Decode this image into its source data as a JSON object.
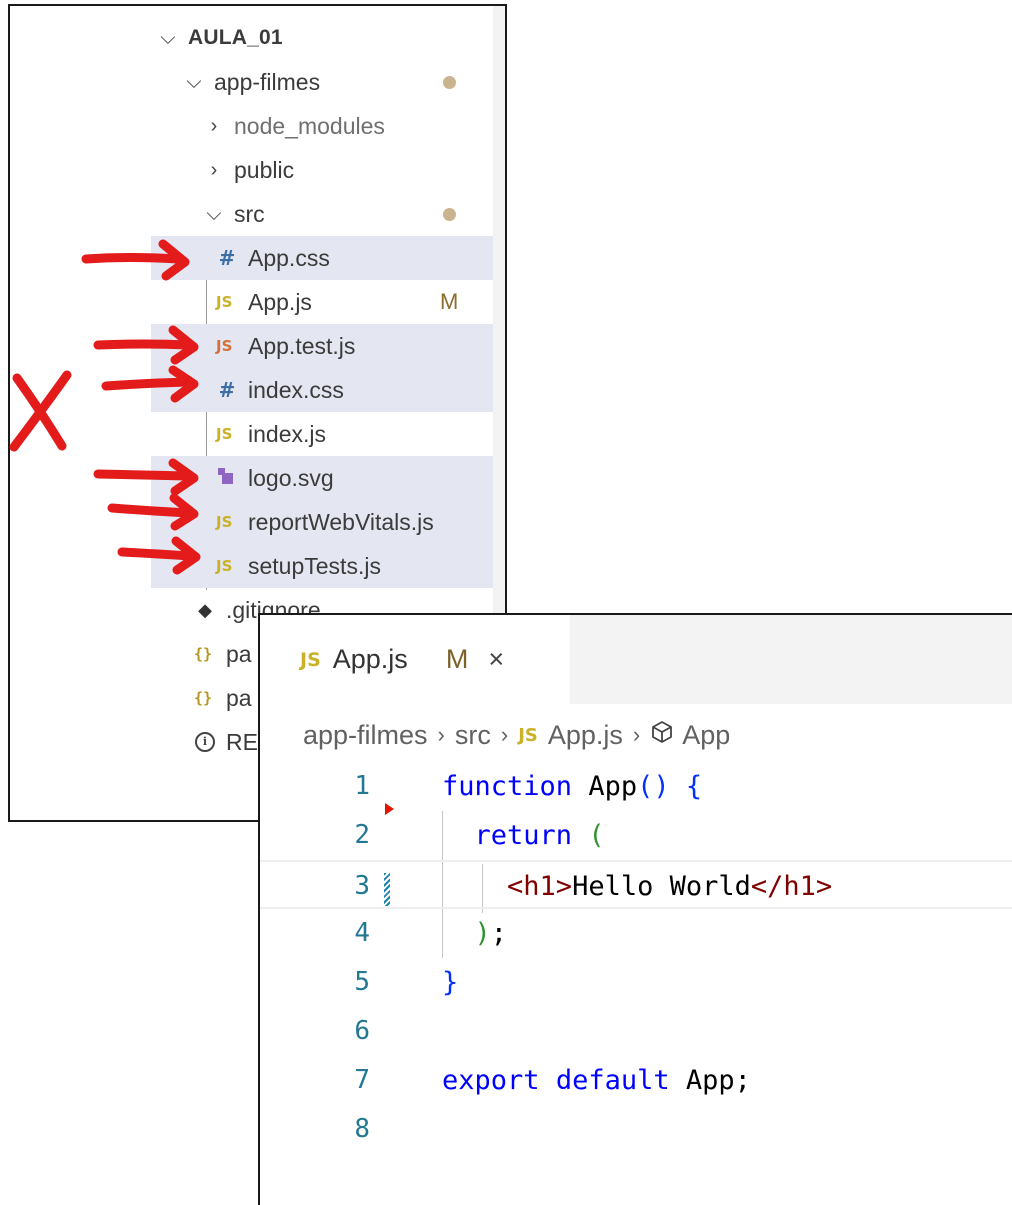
{
  "explorer": {
    "root": "AULA_01",
    "folder": "app-filmes",
    "items": [
      {
        "label": "node_modules"
      },
      {
        "label": "public"
      },
      {
        "label": "src"
      },
      {
        "label": "App.css"
      },
      {
        "label": "App.js",
        "badge": "M"
      },
      {
        "label": "App.test.js"
      },
      {
        "label": "index.css"
      },
      {
        "label": "index.js"
      },
      {
        "label": "logo.svg"
      },
      {
        "label": "reportWebVitals.js"
      },
      {
        "label": "setupTests.js"
      },
      {
        "label": ".gitignore"
      },
      {
        "label": "pa"
      },
      {
        "label": "pa"
      },
      {
        "label": "RE"
      }
    ],
    "js_icon": "JS",
    "css_icon": "#",
    "json_icon": "{}"
  },
  "annotations": {
    "cross_mark": "X",
    "arrow_color": "#e31b1b"
  },
  "editor": {
    "tab": {
      "icon": "JS",
      "label": "App.js",
      "modified": "M",
      "close": "×"
    },
    "breadcrumbs": [
      "app-filmes",
      "src",
      "App.js",
      "App"
    ],
    "breadcrumb_js_icon": "JS",
    "lines": [
      {
        "n": "1"
      },
      {
        "n": "2"
      },
      {
        "n": "3"
      },
      {
        "n": "4"
      },
      {
        "n": "5"
      },
      {
        "n": "6"
      },
      {
        "n": "7"
      },
      {
        "n": "8"
      }
    ],
    "code": {
      "l1_kw": "function",
      "l1_name": "App",
      "l1_paren": "()",
      "l1_brace": "{",
      "l2_kw": "return",
      "l2_paren": "(",
      "l3_open": "<h1>",
      "l3_text": "Hello World",
      "l3_close": "</h1>",
      "l4_paren": ")",
      "l4_semi": ";",
      "l5_brace": "}",
      "l7_kw1": "export",
      "l7_kw2": "default",
      "l7_name": "App",
      "l7_semi": ";"
    }
  },
  "colors": {
    "js_icon": "#c9b227",
    "keyword": "#0000ff",
    "line_number": "#237893",
    "selection": "#e4e6f1",
    "modified_badge": "#8a6c2e"
  }
}
